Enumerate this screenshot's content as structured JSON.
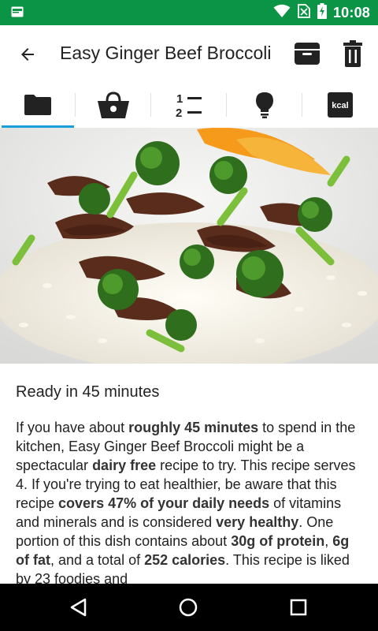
{
  "status_bar": {
    "time": "10:08",
    "icons": [
      "notification-icon",
      "wifi-icon",
      "no-sim-icon",
      "battery-charging-icon"
    ]
  },
  "header": {
    "title": "Easy Ginger Beef Broccoli",
    "back_icon": "arrow-back-icon",
    "actions": [
      "archive-icon",
      "delete-icon"
    ]
  },
  "tabs": [
    {
      "name": "overview",
      "icon": "folder-icon",
      "selected": true
    },
    {
      "name": "ingredients",
      "icon": "basket-icon",
      "selected": false
    },
    {
      "name": "steps",
      "icon": "numbered-list-icon",
      "selected": false
    },
    {
      "name": "tips",
      "icon": "lightbulb-icon",
      "selected": false
    },
    {
      "name": "nutrition",
      "icon": "kcal-icon",
      "selected": false,
      "icon_text": "kcal"
    }
  ],
  "hero_image": {
    "description": "Ginger beef and broccoli stir fry over white rice with orange slices"
  },
  "summary": {
    "ready_text": "Ready in 45 minutes",
    "description": [
      {
        "t": "If you have about ",
        "b": false
      },
      {
        "t": "roughly 45 minutes",
        "b": true
      },
      {
        "t": " to spend in the kitchen, Easy Ginger Beef Broccoli might be a spectacular ",
        "b": false
      },
      {
        "t": "dairy free",
        "b": true
      },
      {
        "t": " recipe to try. This recipe serves 4. If you're trying to eat healthier, be aware that this recipe ",
        "b": false
      },
      {
        "t": "covers 47% of your daily needs",
        "b": true
      },
      {
        "t": " of vitamins and minerals and is considered ",
        "b": false
      },
      {
        "t": "very healthy",
        "b": true
      },
      {
        "t": ". One portion of this dish contains about ",
        "b": false
      },
      {
        "t": "30g of protein",
        "b": true
      },
      {
        "t": ", ",
        "b": false
      },
      {
        "t": "6g of fat",
        "b": true
      },
      {
        "t": ", and a total of ",
        "b": false
      },
      {
        "t": "252 calories",
        "b": true
      },
      {
        "t": ". This recipe is liked by 23 foodies and",
        "b": false
      }
    ]
  },
  "nav_bar": {
    "buttons": [
      "back-triangle-icon",
      "home-circle-icon",
      "recents-square-icon"
    ]
  },
  "colors": {
    "status_bar": "#0b9446",
    "tab_indicator": "#1aa0d8",
    "text": "#222222",
    "nav_bar": "#000000"
  }
}
